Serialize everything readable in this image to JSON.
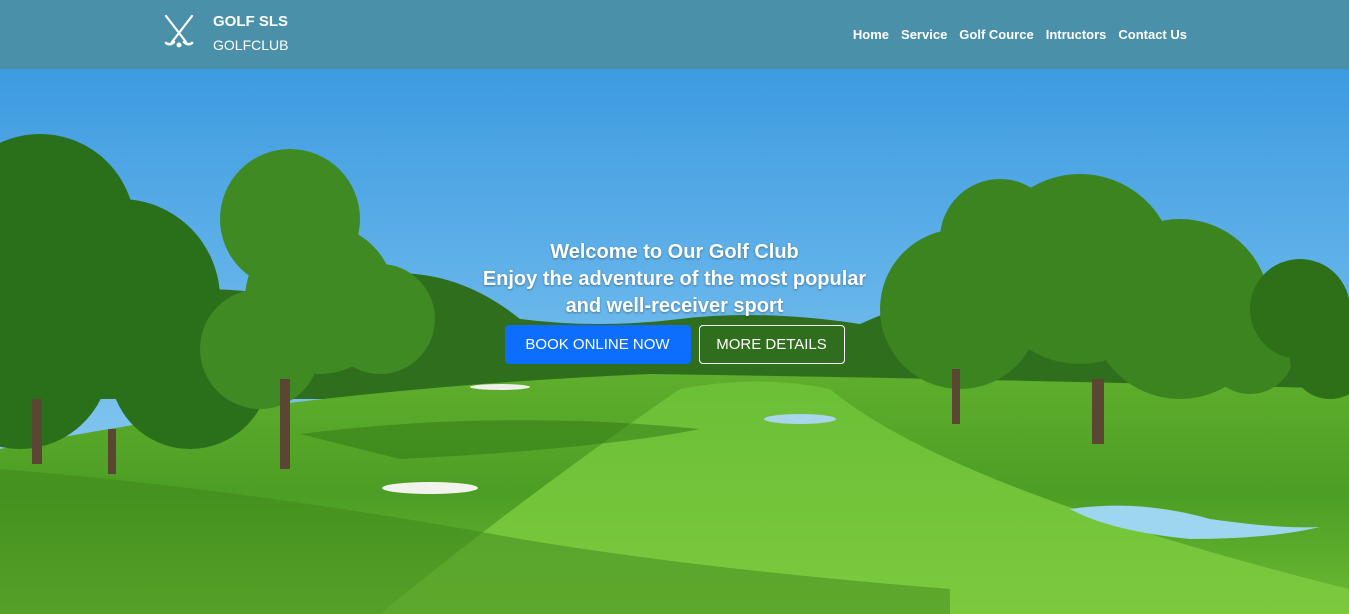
{
  "brand": {
    "name": "GOLF SLS",
    "subtitle": "GOLFCLUB",
    "icon": "crossed-golf-clubs-icon"
  },
  "nav": {
    "items": [
      {
        "label": "Home"
      },
      {
        "label": "Service"
      },
      {
        "label": "Golf Cource"
      },
      {
        "label": "Intructors"
      },
      {
        "label": "Contact Us"
      }
    ]
  },
  "hero": {
    "line1": "Welcome to Our Golf Club",
    "line2": "Enjoy the adventure of the most popular",
    "line3": "and well-receiver sport",
    "primary_button": "BOOK ONLINE NOW",
    "secondary_button": "MORE DETAILS"
  },
  "colors": {
    "navbar": "#4b90a9",
    "primary_button": "#0d6efd",
    "text": "#ffffff"
  }
}
